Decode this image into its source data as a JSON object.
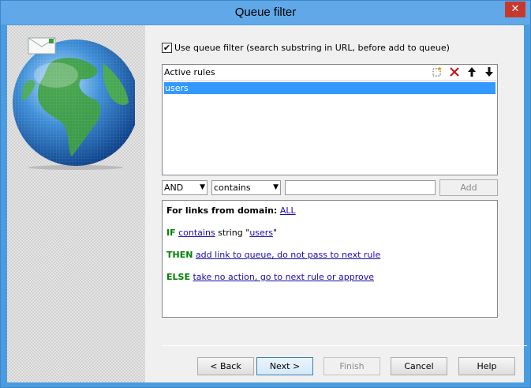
{
  "window": {
    "title": "Queue filter",
    "close_label": "✕"
  },
  "filter": {
    "checkbox_checked": true,
    "checkbox_mark": "✔",
    "checkbox_label": "Use queue filter (search substring in URL, before add to queue)"
  },
  "rules": {
    "header": "Active rules",
    "toolbar_icons": [
      "new-rule-icon",
      "delete-icon",
      "arrow-up-icon",
      "arrow-down-icon"
    ],
    "items": [
      "users"
    ]
  },
  "condition": {
    "logic_value": "AND",
    "match_value": "contains",
    "text_value": "",
    "add_label": "Add"
  },
  "description": {
    "for_links_label": "For links from domain:",
    "domain_link": "ALL",
    "if_keyword": "IF",
    "if_link": "contains",
    "if_string_label": "string \"",
    "if_value_link": "users",
    "if_close_quote": "\"",
    "then_keyword": "THEN",
    "then_link": "add link to queue, do not pass to next rule",
    "else_keyword": "ELSE",
    "else_link": "take no action, go to next rule or approve"
  },
  "buttons": {
    "back": "< Back",
    "next": "Next >",
    "finish": "Finish",
    "cancel": "Cancel",
    "help": "Help"
  },
  "colors": {
    "selection": "#3399ff",
    "keyword_green": "#008000",
    "link_blue": "#1a0dab",
    "title_bar": "#60a8e8",
    "close_button": "#c7392d"
  }
}
